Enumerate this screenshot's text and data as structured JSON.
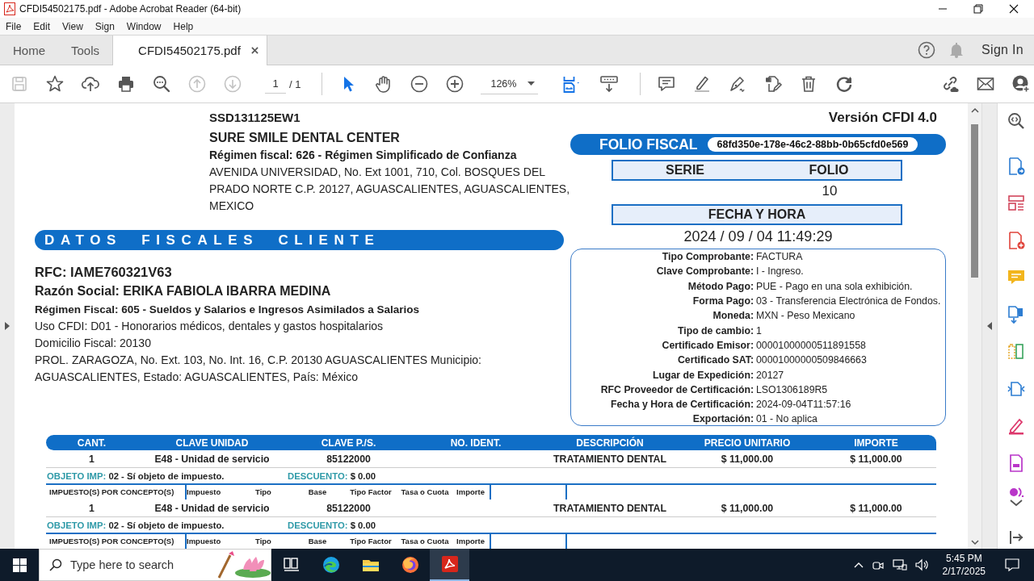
{
  "window": {
    "title": "CFDI54502175.pdf - Adobe Acrobat Reader (64-bit)"
  },
  "menu": [
    "File",
    "Edit",
    "View",
    "Sign",
    "Window",
    "Help"
  ],
  "tabs": [
    {
      "label": "Home",
      "selected": false
    },
    {
      "label": "Tools",
      "selected": false
    },
    {
      "label": "CFDI54502175.pdf",
      "selected": true
    }
  ],
  "account": {
    "sign_in": "Sign In"
  },
  "toolbar": {
    "tools": [
      {
        "kind": "save",
        "disabled": true
      },
      {
        "kind": "star",
        "disabled": false
      },
      {
        "kind": "upload",
        "disabled": false
      },
      {
        "kind": "print",
        "disabled": false
      },
      {
        "kind": "find",
        "disabled": false
      },
      {
        "kind": "prev",
        "disabled": true
      },
      {
        "kind": "next",
        "disabled": true
      },
      {
        "kind": "page",
        "value": "1",
        "total": "/ 1"
      },
      {
        "kind": "divider"
      },
      {
        "kind": "pointer",
        "disabled": false
      },
      {
        "kind": "hand",
        "disabled": false
      },
      {
        "kind": "zoom_out",
        "disabled": false
      },
      {
        "kind": "zoom_in",
        "disabled": false
      },
      {
        "kind": "zoom",
        "value": "126%"
      },
      {
        "kind": "fit",
        "disabled": false
      },
      {
        "kind": "scroll",
        "disabled": false
      },
      {
        "kind": "divider"
      },
      {
        "kind": "comment",
        "disabled": false
      },
      {
        "kind": "highlight",
        "disabled": false
      },
      {
        "kind": "sign",
        "disabled": false
      },
      {
        "kind": "edit",
        "disabled": false
      },
      {
        "kind": "trash",
        "disabled": false
      },
      {
        "kind": "rotate",
        "disabled": false
      }
    ],
    "share_tools": [
      {
        "kind": "link"
      },
      {
        "kind": "mail"
      },
      {
        "kind": "add_user"
      }
    ]
  },
  "document": {
    "issuer": {
      "rfc": "SSD131125EW1",
      "name": "SURE SMILE DENTAL CENTER",
      "regime": "Régimen fiscal: 626 - Régimen Simplificado de Confianza",
      "address": "AVENIDA UNIVERSIDAD, No. Ext 1001, 710, Col. BOSQUES DEL PRADO NORTE C.P. 20127, AGUASCALIENTES, AGUASCALIENTES, MEXICO"
    },
    "client_heading": "DATOS FISCALES CLIENTE",
    "client": {
      "rfc": "RFC: IAME760321V63",
      "name": "Razón Social: ERIKA FABIOLA IBARRA MEDINA",
      "regime": "Régimen Fiscal: 605 - Sueldos y Salarios e Ingresos Asimilados a Salarios",
      "uso": "Uso CFDI: D01 - Honorarios médicos, dentales y gastos hospitalarios",
      "domicilio": "Domicilio Fiscal: 20130",
      "address": "PROL. ZARAGOZA, No. Ext. 103, No. Int. 16, C.P. 20130 AGUASCALIENTES Municipio: AGUASCALIENTES, Estado: AGUASCALIENTES, País: México"
    },
    "version": "Versión CFDI 4.0",
    "folio_fiscal": {
      "label": "FOLIO FISCAL",
      "value": "68fd350e-178e-46c2-88bb-0b65cfd0e569"
    },
    "serie_label": "SERIE",
    "folio_label": "FOLIO",
    "folio": "10",
    "date_label": "FECHA Y HORA",
    "date": "2024 / 09 / 04 11:49:29",
    "details": [
      {
        "label": "Tipo Comprobante:",
        "value": "FACTURA"
      },
      {
        "label": "Clave Comprobante:",
        "value": "I - Ingreso."
      },
      {
        "label": "Método Pago:",
        "value": "PUE - Pago en una sola exhibición."
      },
      {
        "label": "Forma Pago:",
        "value": "03 - Transferencia Electrónica de Fondos."
      },
      {
        "label": "Moneda:",
        "value": "MXN - Peso Mexicano"
      },
      {
        "label": "Tipo de cambio:",
        "value": "1"
      },
      {
        "label": "Certificado Emisor:",
        "value": "00001000000511891558"
      },
      {
        "label": "Certificado SAT:",
        "value": "00001000000509846663"
      },
      {
        "label": "Lugar de Expedición:",
        "value": "20127"
      },
      {
        "label": "RFC Proveedor de Certificación:",
        "value": "LSO1306189R5"
      },
      {
        "label": "Fecha y Hora de Certificación:",
        "value": "2024-09-04T11:57:16"
      },
      {
        "label": "Exportación:",
        "value": "01 - No aplica"
      }
    ],
    "items": {
      "columns": [
        "CANT.",
        "CLAVE UNIDAD",
        "CLAVE P./S.",
        "NO. IDENT.",
        "DESCRIPCIÓN",
        "PRECIO UNITARIO",
        "IMPORTE"
      ],
      "rows": [
        {
          "cant": "1",
          "unidad": "E48 - Unidad de servicio",
          "clave": "85122000",
          "descripcion": "TRATAMIENTO DENTAL",
          "precio": "$ 11,000.00",
          "importe": "$ 11,000.00",
          "objeto_label": "OBJETO IMP:",
          "objeto": "02 - Sí objeto de impuesto.",
          "descuento_label": "DESCUENTO:",
          "descuento": "$ 0.00",
          "tax_label": "IMPUESTO(S) POR CONCEPTO(S)",
          "tax_columns": [
            "Impuesto",
            "Tipo",
            "Base",
            "Tipo Factor",
            "Tasa o Cuota",
            "Importe"
          ]
        },
        {
          "cant": "1",
          "unidad": "E48 - Unidad de servicio",
          "clave": "85122000",
          "descripcion": "TRATAMIENTO DENTAL",
          "precio": "$ 11,000.00",
          "importe": "$ 11,000.00",
          "objeto_label": "OBJETO IMP:",
          "objeto": "02 - Sí objeto de impuesto.",
          "descuento_label": "DESCUENTO:",
          "descuento": "$ 0.00",
          "tax_label": "IMPUESTO(S) POR CONCEPTO(S)",
          "tax_columns": [
            "Impuesto",
            "Tipo",
            "Base",
            "Tipo Factor",
            "Tasa o Cuota",
            "Importe"
          ]
        }
      ]
    }
  },
  "right_panel": [
    {
      "kind": "zoom"
    },
    {
      "kind": "export"
    },
    {
      "kind": "organize"
    },
    {
      "kind": "create"
    },
    {
      "kind": "comment"
    },
    {
      "kind": "combine"
    },
    {
      "kind": "compare"
    },
    {
      "kind": "scan"
    },
    {
      "kind": "fill_sign"
    },
    {
      "kind": "form"
    },
    {
      "kind": "partial"
    },
    {
      "kind": "more"
    },
    {
      "kind": "collapse"
    }
  ],
  "taskbar": {
    "search_placeholder": "Type here to search",
    "apps": [
      {
        "kind": "task_view",
        "active": false
      },
      {
        "kind": "edge",
        "active": false
      },
      {
        "kind": "explorer",
        "active": false
      },
      {
        "kind": "firefox",
        "active": false
      },
      {
        "kind": "acrobat",
        "active": true
      }
    ],
    "time": "5:45 PM",
    "date": "2/17/2025"
  }
}
